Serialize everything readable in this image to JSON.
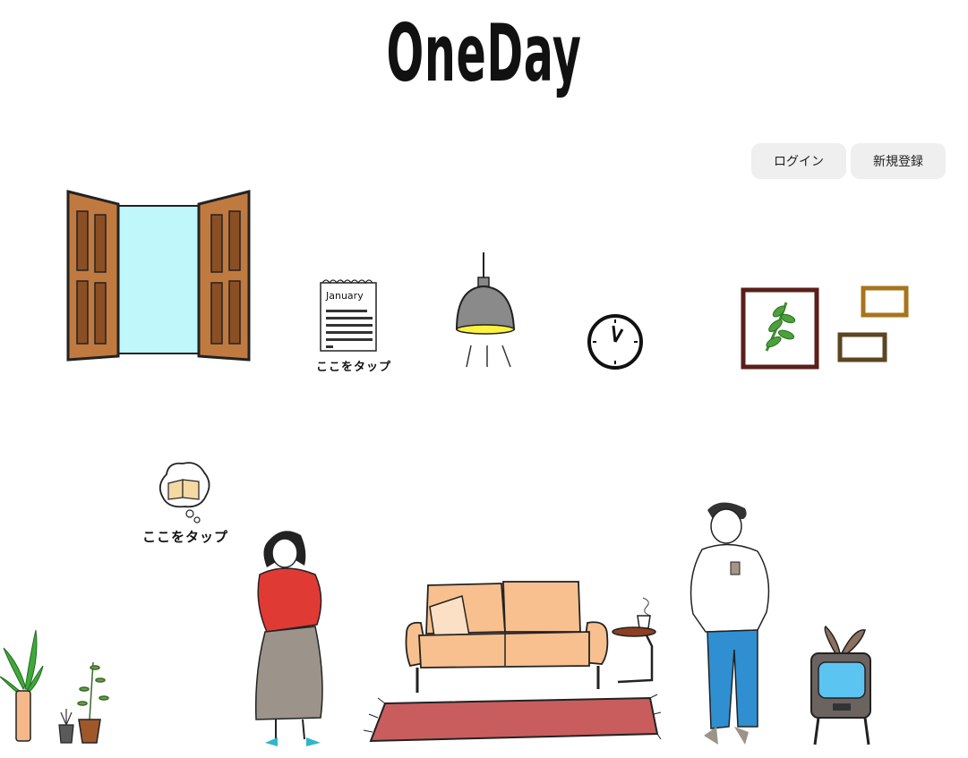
{
  "header": {
    "logo_text": "OneDay"
  },
  "auth": {
    "login_label": "ログイン",
    "signup_label": "新規登録"
  },
  "calendar": {
    "month": "January",
    "tap_label": "ここをタップ"
  },
  "thought": {
    "tap_label": "ここをタップ"
  },
  "colors": {
    "door_wood": "#c07a3f",
    "window_sky": "#bff7fb",
    "sweater_red": "#e03a35",
    "sofa_peach": "#f7c08e",
    "rug_red": "#c95d5e",
    "jeans_blue": "#2f8fd1",
    "tv_screen": "#5cc4f1"
  }
}
